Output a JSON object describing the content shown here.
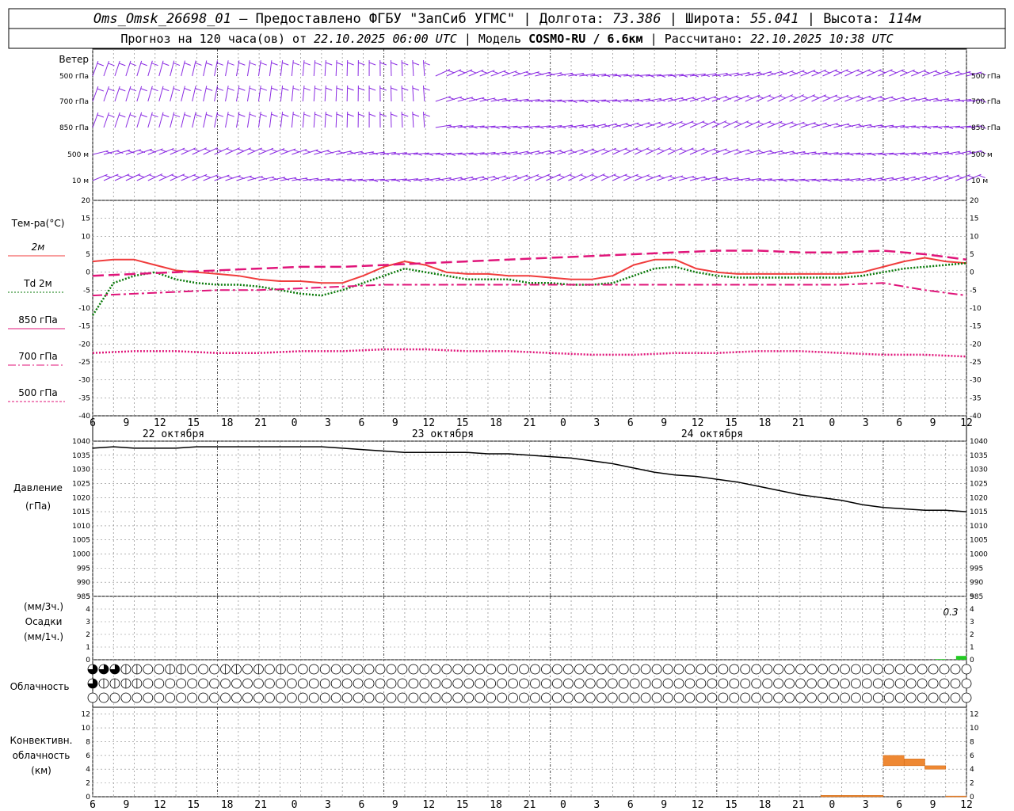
{
  "header": {
    "station": "Oms_Omsk_26698_01",
    "provider": "Предоставлено ФГБУ \"ЗапСиб УГМС\"",
    "lon_label": "Долгота:",
    "lon": "73.386",
    "lat_label": "Широта:",
    "lat": "55.041",
    "alt_label": "Высота:",
    "alt": "114м",
    "forecast_label": "Прогноз на 120 часа(ов) от",
    "forecast_time": "22.10.2025 06:00 UTC",
    "model_label": "Модель",
    "model": "COSMO-RU / 6.6км",
    "calc_label": "Рассчитано:",
    "calc_time": "22.10.2025 10:38 UTC"
  },
  "colors": {
    "wind": "#8a2be2",
    "t2m": "#f03c3c",
    "td2m": "#0a7a0a",
    "t850": "#e0157a",
    "t700": "#e0157a",
    "t500": "#e0157a",
    "pressure": "#000000",
    "precip": "#22cc22",
    "conv": "#ee8833",
    "grid": "#888888"
  },
  "labels": {
    "wind": "Ветер",
    "wind_levels": [
      "500 гПа",
      "700 гПа",
      "850 гПа",
      "500 м",
      "10 м"
    ],
    "temp": "Тем-ра(°C)",
    "legend_2m": "2м",
    "legend_td": "Td 2м",
    "legend_850": "850 гПа",
    "legend_700": "700 гПа",
    "legend_500": "500 гПа",
    "pressure1": "Давление",
    "pressure2": "(гПа)",
    "precip1": "(мм/3ч.)",
    "precip2": "Осадки",
    "precip3": "(мм/1ч.)",
    "precip_value": "0.3",
    "cloud": "Облачность",
    "conv1": "Конвективн.",
    "conv2": "облачность",
    "conv3": "(км)"
  },
  "x_ticks": [
    "6",
    "9",
    "12",
    "15",
    "18",
    "21",
    "0",
    "3",
    "6",
    "9",
    "12",
    "15",
    "18",
    "21",
    "0",
    "3",
    "6",
    "9",
    "12",
    "15",
    "18",
    "21",
    "0",
    "3",
    "6",
    "9",
    "12"
  ],
  "dates": [
    "22 октября",
    "23 октября",
    "24 октября"
  ],
  "chart_data": [
    {
      "type": "line",
      "panel": "temperature",
      "x_unit": "forecast hour",
      "ylim": [
        -40,
        20
      ],
      "yticks": [
        20,
        15,
        10,
        5,
        0,
        -5,
        -10,
        -15,
        -20,
        -25,
        -30,
        -35,
        -40
      ],
      "series": [
        {
          "name": "2м",
          "x": [
            0,
            3,
            6,
            9,
            12,
            15,
            18,
            21,
            24,
            27,
            30,
            33,
            36,
            39,
            42,
            45,
            48,
            51,
            54,
            57,
            60,
            63,
            66,
            69,
            72,
            75,
            78,
            81,
            84,
            87,
            90,
            93,
            96,
            99,
            102,
            105,
            108,
            111,
            114,
            117,
            120,
            123,
            126
          ],
          "values": [
            3,
            3.5,
            3.5,
            2,
            0.5,
            0,
            -0.5,
            -1,
            -2,
            -2.5,
            -2.5,
            -3,
            -3,
            -1,
            1.5,
            3,
            2,
            0,
            -0.5,
            -0.5,
            -1,
            -1,
            -1.5,
            -2,
            -2,
            -1,
            2,
            3.5,
            3.5,
            1,
            0,
            -0.5,
            -0.5,
            -0.5,
            -0.5,
            -0.5,
            -0.5,
            0,
            1.5,
            3,
            4,
            3,
            2.5
          ]
        },
        {
          "name": "Td 2м",
          "x": [
            0,
            3,
            6,
            9,
            12,
            15,
            18,
            21,
            24,
            27,
            30,
            33,
            36,
            39,
            42,
            45,
            48,
            51,
            54,
            57,
            60,
            63,
            66,
            69,
            72,
            75,
            78,
            81,
            84,
            87,
            90,
            93,
            96,
            99,
            102,
            105,
            108,
            111,
            114,
            117,
            120,
            123,
            126
          ],
          "values": [
            -12,
            -3,
            -1,
            0,
            -2,
            -3,
            -3.5,
            -3.5,
            -4,
            -5,
            -6,
            -6.5,
            -5,
            -3,
            -1,
            1,
            0,
            -1,
            -2,
            -2,
            -2,
            -3,
            -3,
            -3.5,
            -3.5,
            -3,
            -1,
            1,
            1.5,
            0,
            -1,
            -1.5,
            -1.5,
            -1.5,
            -1.5,
            -1.5,
            -1.5,
            -1,
            0,
            1,
            1.5,
            2,
            2.5
          ]
        },
        {
          "name": "850 гПа",
          "x": [
            0,
            6,
            12,
            18,
            24,
            30,
            36,
            42,
            48,
            54,
            60,
            66,
            72,
            78,
            84,
            90,
            96,
            102,
            108,
            114,
            120,
            126
          ],
          "values": [
            -1,
            -0.5,
            0,
            0.5,
            1,
            1.5,
            1.5,
            2,
            2.5,
            3,
            3.5,
            4,
            4.5,
            5,
            5.5,
            6,
            6,
            5.5,
            5.5,
            6,
            5,
            3.5
          ]
        },
        {
          "name": "700 гПа",
          "x": [
            0,
            6,
            12,
            18,
            24,
            30,
            36,
            42,
            48,
            54,
            60,
            66,
            72,
            78,
            84,
            90,
            96,
            102,
            108,
            114,
            120,
            126
          ],
          "values": [
            -6.5,
            -6,
            -5.5,
            -5,
            -5,
            -4.5,
            -4,
            -3.5,
            -3.5,
            -3.5,
            -3.5,
            -3.5,
            -3.5,
            -3.5,
            -3.5,
            -3.5,
            -3.5,
            -3.5,
            -3.5,
            -3,
            -5,
            -6.5
          ]
        },
        {
          "name": "500 гПа",
          "x": [
            0,
            6,
            12,
            18,
            24,
            30,
            36,
            42,
            48,
            54,
            60,
            66,
            72,
            78,
            84,
            90,
            96,
            102,
            108,
            114,
            120,
            126
          ],
          "values": [
            -22.5,
            -22,
            -22,
            -22.5,
            -22.5,
            -22,
            -22,
            -21.5,
            -21.5,
            -22,
            -22,
            -22.5,
            -23,
            -23,
            -22.5,
            -22.5,
            -22,
            -22,
            -22.5,
            -23,
            -23,
            -23.5
          ]
        }
      ]
    },
    {
      "type": "line",
      "panel": "pressure",
      "name": "Давление",
      "ylim": [
        985,
        1040
      ],
      "yticks": [
        1040,
        1035,
        1030,
        1025,
        1020,
        1015,
        1010,
        1005,
        1000,
        995,
        990,
        985
      ],
      "x": [
        0,
        3,
        6,
        9,
        12,
        15,
        18,
        21,
        24,
        27,
        30,
        33,
        36,
        39,
        42,
        45,
        48,
        51,
        54,
        57,
        60,
        63,
        66,
        69,
        72,
        75,
        78,
        81,
        84,
        87,
        90,
        93,
        96,
        99,
        102,
        105,
        108,
        111,
        114,
        117,
        120,
        123,
        126
      ],
      "values": [
        1037.5,
        1038,
        1037.5,
        1037.5,
        1037.5,
        1038,
        1038,
        1038,
        1038,
        1038,
        1038,
        1038,
        1037.5,
        1037,
        1036.5,
        1036,
        1036,
        1036,
        1036,
        1035.5,
        1035.5,
        1035,
        1034.5,
        1034,
        1033,
        1032,
        1030.5,
        1029,
        1028,
        1027.5,
        1026.5,
        1025.5,
        1024,
        1022.5,
        1021,
        1020,
        1019,
        1017.5,
        1016.5,
        1016,
        1015.5,
        1015.5,
        1015
      ]
    },
    {
      "type": "bar",
      "panel": "precipitation",
      "ylim": [
        0,
        5
      ],
      "yticks": [
        5,
        4,
        3,
        2,
        1,
        0
      ],
      "x": [
        123,
        126
      ],
      "values": [
        0.05,
        0.3
      ]
    },
    {
      "type": "table",
      "panel": "cloudiness",
      "rows": [
        {
          "name": "upper",
          "x_step": 1.5,
          "cover": [
            0.75,
            0.75,
            0.75,
            0.5,
            0.5,
            0,
            0,
            0.5,
            0.5,
            0,
            0,
            0,
            0.5,
            0.5,
            0,
            0.5,
            0,
            0.5,
            0,
            0,
            0,
            0,
            0,
            0,
            0,
            0,
            0,
            0,
            0,
            0,
            0,
            0,
            0,
            0,
            0,
            0,
            0,
            0,
            0,
            0,
            0,
            0,
            0,
            0,
            0,
            0,
            0,
            0,
            0,
            0,
            0,
            0,
            0,
            0,
            0,
            0,
            0,
            0,
            0,
            0,
            0,
            0,
            0,
            0,
            0,
            0,
            0,
            0,
            0,
            0,
            0,
            0,
            0,
            0,
            0,
            0,
            0,
            0,
            0,
            0,
            0,
            0,
            0,
            0,
            0,
            0.75,
            0.75,
            0.75,
            0.75
          ]
        },
        {
          "name": "middle",
          "x_step": 1.5,
          "cover": [
            0.75,
            0.5,
            0.5,
            0.5,
            0.5,
            0,
            0,
            0,
            0,
            0,
            0,
            0,
            0,
            0,
            0,
            0,
            0,
            0,
            0,
            0,
            0,
            0,
            0,
            0,
            0,
            0,
            0,
            0,
            0,
            0,
            0,
            0,
            0,
            0,
            0,
            0,
            0,
            0,
            0,
            0,
            0,
            0,
            0,
            0,
            0,
            0,
            0,
            0,
            0,
            0,
            0,
            0,
            0,
            0,
            0,
            0,
            0,
            0,
            0,
            0,
            0,
            0,
            0,
            0,
            0,
            0,
            0,
            0,
            0,
            0,
            0,
            0,
            0,
            0,
            0,
            0,
            0,
            0,
            0,
            0,
            0,
            0,
            0,
            0,
            0,
            0,
            0,
            0,
            0,
            0,
            0
          ]
        },
        {
          "name": "lower",
          "x_step": 1.5,
          "cover": [
            0,
            0,
            0,
            0,
            0,
            0,
            0,
            0,
            0,
            0,
            0,
            0,
            0,
            0,
            0,
            0,
            0,
            0,
            0,
            0,
            0,
            0,
            0,
            0,
            0,
            0,
            0,
            0,
            0,
            0,
            0,
            0,
            0,
            0,
            0,
            0,
            0,
            0,
            0,
            0,
            0,
            0,
            0,
            0,
            0,
            0,
            0,
            0,
            0,
            0,
            0,
            0,
            0,
            0,
            0,
            0,
            0,
            0,
            0,
            0,
            0,
            0,
            0,
            0,
            0,
            0,
            0,
            0,
            0,
            0,
            0,
            0,
            0,
            0,
            0,
            0,
            0,
            0,
            0,
            0,
            0,
            0,
            0,
            0,
            0,
            0,
            0,
            0.75,
            0,
            0,
            0.75
          ]
        }
      ]
    },
    {
      "type": "bar",
      "panel": "convective",
      "ylim": [
        0,
        13
      ],
      "yticks": [
        12,
        10,
        8,
        6,
        4,
        2,
        0
      ],
      "x": [
        108,
        111,
        114,
        117,
        120,
        123,
        126
      ],
      "base": [
        0,
        0,
        0,
        4.5,
        4.5,
        4,
        0
      ],
      "top": [
        0.2,
        0.2,
        0.2,
        6,
        5.5,
        4.5,
        0.1
      ]
    },
    {
      "type": "line",
      "panel": "wind",
      "levels": [
        "500 гПа",
        "700 гПа",
        "850 гПа",
        "500 м",
        "10 м"
      ]
    }
  ]
}
